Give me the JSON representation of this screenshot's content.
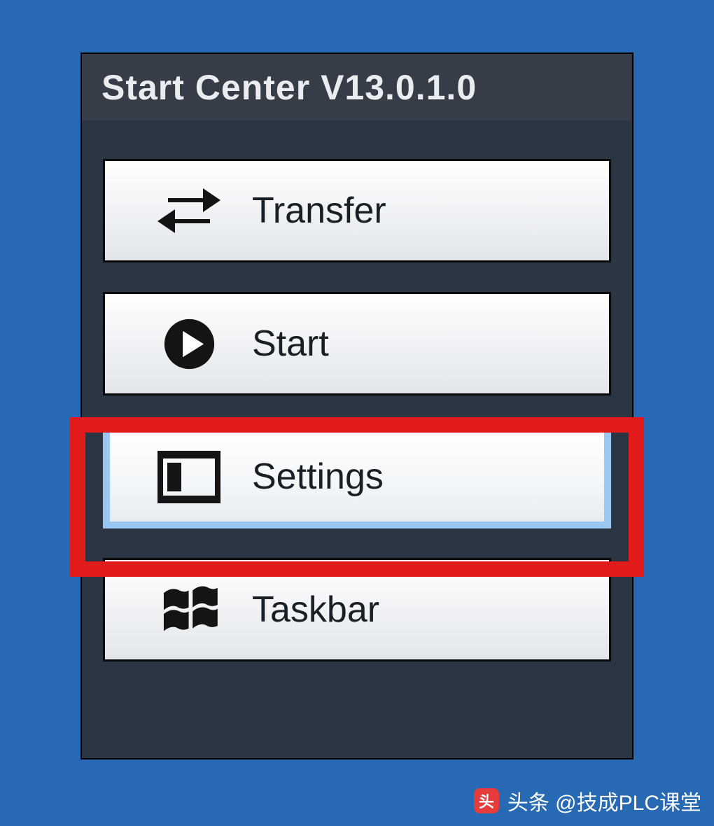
{
  "panel": {
    "title": "Start Center V13.0.1.0"
  },
  "menu": {
    "items": [
      {
        "label": "Transfer",
        "icon": "transfer-icon",
        "selected": false
      },
      {
        "label": "Start",
        "icon": "play-icon",
        "selected": false
      },
      {
        "label": "Settings",
        "icon": "settings-icon",
        "selected": true
      },
      {
        "label": "Taskbar",
        "icon": "windows-icon",
        "selected": false
      }
    ]
  },
  "watermark": {
    "text": "头条 @技成PLC课堂"
  }
}
